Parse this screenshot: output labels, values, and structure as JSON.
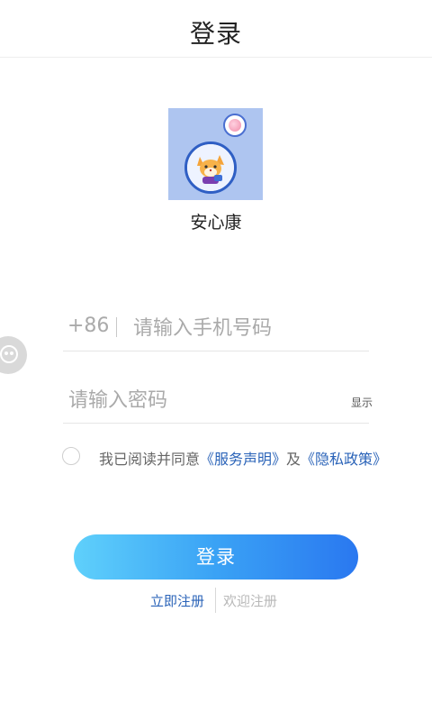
{
  "header": {
    "title": "登录"
  },
  "app": {
    "name": "安心康"
  },
  "login_form": {
    "country_code": "+86",
    "phone_placeholder": "请输入手机号码",
    "password_placeholder": "请输入密码",
    "show_password_label": "显示"
  },
  "agreement": {
    "prefix": "我已阅读并同意",
    "service_link": "《服务声明》",
    "conjunction": "及",
    "privacy_link": "《隐私政策》",
    "checked": false
  },
  "login_button": {
    "label": "登录"
  },
  "footer": {
    "register_label": "立即注册",
    "welcome_label": "欢迎注册"
  },
  "colors": {
    "link": "#2a63b8",
    "button_gradient_start": "#5fd0fb",
    "button_gradient_end": "#2a78f0",
    "logo_background": "#aec5f0"
  }
}
